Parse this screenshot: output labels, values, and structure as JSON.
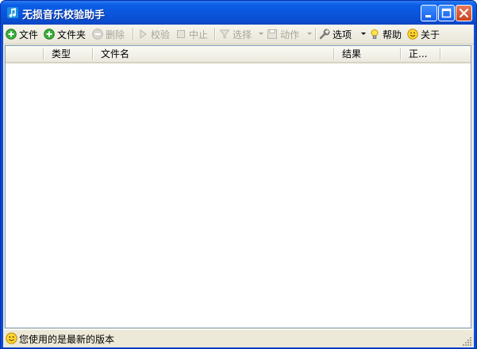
{
  "window": {
    "title": "无损音乐校验助手",
    "icons": {
      "app": "music-note-icon",
      "minimize": "minimize-icon",
      "maximize": "maximize-icon",
      "close": "close-icon"
    },
    "colors": {
      "titlebar": "#0a55dc",
      "close": "#c9431f",
      "face": "#ece9d8"
    }
  },
  "toolbar": {
    "file": "文件",
    "folder": "文件夹",
    "delete": "删除",
    "verify": "校验",
    "stop": "中止",
    "select": "选择",
    "action": "动作",
    "options": "选项",
    "help": "帮助",
    "about": "关于",
    "disabled_items": [
      "删除",
      "校验",
      "中止",
      "选择",
      "动作"
    ]
  },
  "list": {
    "columns": [
      "",
      "类型",
      "文件名",
      "结果",
      "正..."
    ],
    "rows": []
  },
  "status": {
    "message": "您使用的是最新的版本"
  }
}
